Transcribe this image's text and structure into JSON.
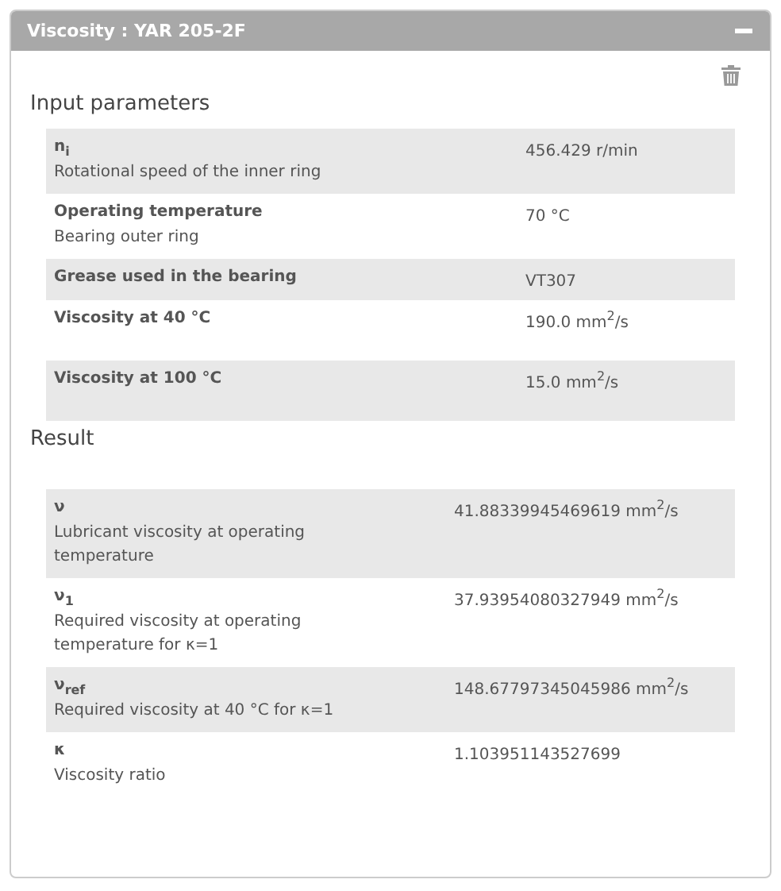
{
  "panel": {
    "title": "Viscosity : YAR 205-2F",
    "expanded": true
  },
  "sections": [
    {
      "kind": "input",
      "heading": "Input parameters",
      "rows": [
        {
          "name": "n$_{i}$",
          "description": "Rotational speed of the inner ring",
          "value": "456.429 r/min"
        },
        {
          "name": "Operating temperature",
          "description": "Bearing outer ring",
          "value": "70 °C"
        },
        {
          "name": "Grease used in the bearing",
          "value": "VT307"
        },
        {
          "name": "Viscosity at 40 °C",
          "value": "190.0 mm$^{2}$/s"
        },
        {
          "name": "Viscosity at 100 °C",
          "value": "15.0 mm$^{2}$/s"
        }
      ]
    },
    {
      "kind": "result",
      "heading": "Result",
      "rows": [
        {
          "name": "ν",
          "description": "Lubricant viscosity at operating temperature",
          "value": "41.88339945469619 mm$^{2}$/s"
        },
        {
          "name": "ν$_{1}$",
          "description": "Required viscosity at operating temperature for κ=1",
          "value": "37.93954080327949 mm$^{2}$/s"
        },
        {
          "name": "ν$_{ref}$",
          "description": "Required viscosity at 40 °C for κ=1",
          "value": "148.67797345045986 mm$^{2}$/s"
        },
        {
          "name": "κ",
          "description": "Viscosity ratio",
          "value": "1.103951143527699"
        }
      ]
    }
  ]
}
